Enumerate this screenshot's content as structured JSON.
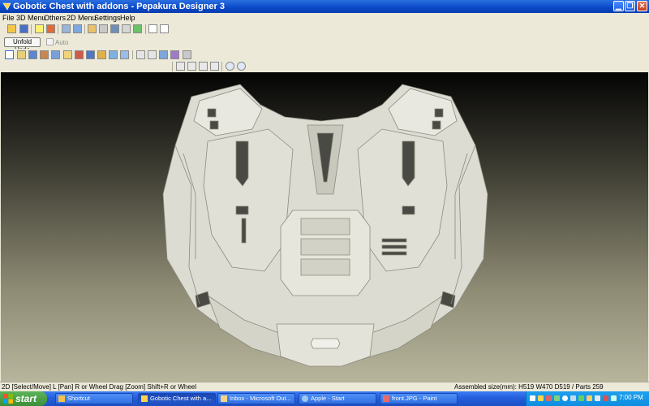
{
  "window": {
    "title": "Gobotic Chest with addons - Pepakura Designer 3"
  },
  "menu": [
    "File",
    "3D Menu",
    "Others",
    "2D Menu",
    "Settings",
    "Help"
  ],
  "toolbar2": {
    "undo_label": "Unfold Undo",
    "auto_label": "Auto"
  },
  "status": {
    "left": "2D [Select/Move] L [Pan] R or Wheel Drag [Zoom] Shift+R or Wheel",
    "right": "Assembled size(mm): H519 W470 D519 / Parts 259"
  },
  "taskbar": {
    "start_label": "start",
    "tasks": [
      "Shortcut",
      "Gobotic Chest with a...",
      "Inbox - Microsoft Out...",
      "Apple - Start",
      "front.JPG - Paint"
    ],
    "clock": "7:00 PM"
  },
  "colors": {
    "title_blue": "#0a48c8",
    "taskbar_blue": "#245edc",
    "start_green": "#3c8f39",
    "model_grey": "#dcdcd2"
  }
}
